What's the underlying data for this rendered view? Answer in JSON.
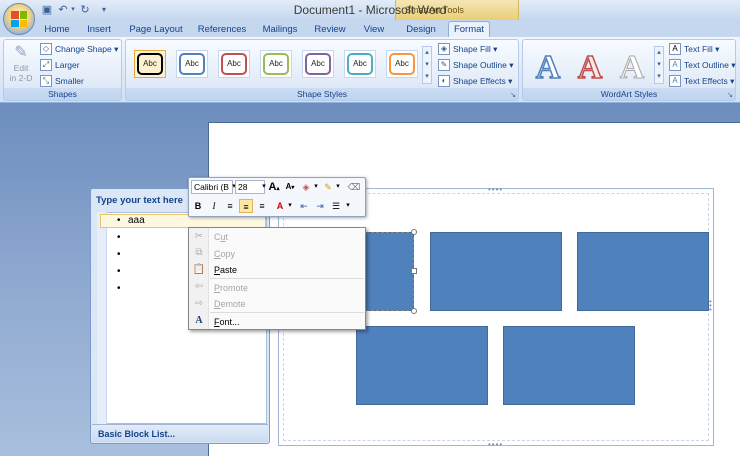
{
  "window": {
    "title": "Document1 - Microsoft Word"
  },
  "contextual": {
    "label": "SmartArt Tools"
  },
  "tabs": [
    "Home",
    "Insert",
    "Page Layout",
    "References",
    "Mailings",
    "Review",
    "View",
    "Design",
    "Format"
  ],
  "ribbon": {
    "shapes": {
      "label": "Shapes",
      "edit2d": "Edit",
      "edit2d_sub": "in 2-D",
      "change_shape": "Change Shape ▾",
      "larger": "Larger",
      "smaller": "Smaller"
    },
    "shape_styles": {
      "label": "Shape Styles",
      "thumb_text": "Abc",
      "border_colors": [
        "#000000",
        "#4f81bd",
        "#c0504d",
        "#9bbb59",
        "#8064a2",
        "#4bacc6",
        "#f79646"
      ],
      "shape_fill": "Shape Fill ▾",
      "shape_outline": "Shape Outline ▾",
      "shape_effects": "Shape Effects ▾"
    },
    "wordart": {
      "label": "WordArt Styles",
      "letter": "A",
      "text_fill": "Text Fill ▾",
      "text_outline": "Text Outline ▾",
      "text_effects": "Text Effects ▾"
    }
  },
  "mini_toolbar": {
    "font": "Calibri (B",
    "size": "28"
  },
  "text_pane": {
    "title": "Type your text here",
    "items": [
      "aaa",
      "",
      "",
      "",
      ""
    ],
    "footer": "Basic Block List..."
  },
  "context_menu": [
    {
      "label": "Cut",
      "enabled": false
    },
    {
      "label": "Copy",
      "enabled": false
    },
    {
      "label": "Paste",
      "enabled": true
    },
    {
      "label": "Promote",
      "enabled": false
    },
    {
      "label": "Demote",
      "enabled": false
    },
    {
      "label": "Font...",
      "enabled": true
    }
  ],
  "colors": {
    "accent": "#15428b",
    "block": "#4f81bd"
  }
}
